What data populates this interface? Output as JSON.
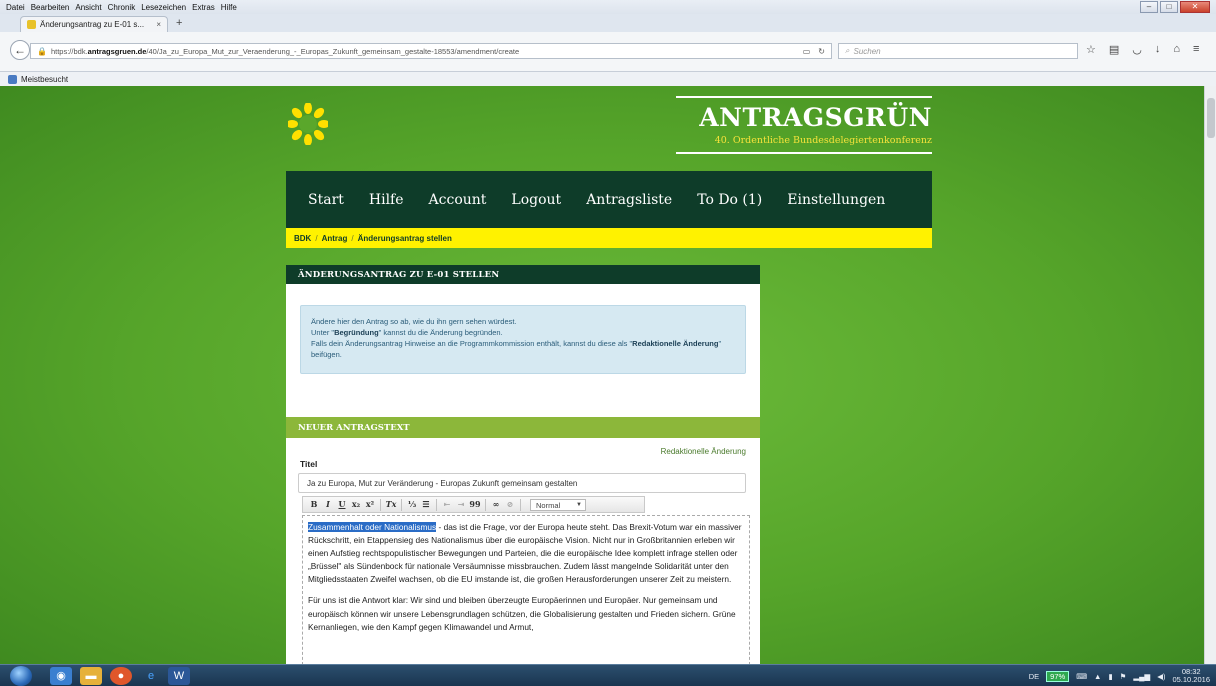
{
  "browser": {
    "menu": [
      {
        "label": "Datei"
      },
      {
        "label": "Bearbeiten"
      },
      {
        "label": "Ansicht"
      },
      {
        "label": "Chronik"
      },
      {
        "label": "Lesezeichen"
      },
      {
        "label": "Extras"
      },
      {
        "label": "Hilfe"
      }
    ],
    "tab_title": "Änderungsantrag zu E-01 s...",
    "tab_close": "×",
    "new_tab": "+",
    "url_host": "https://bdk.antragsgruen.de",
    "url_host_bold": "antragsgruen.de",
    "url_path": "/40/Ja_zu_Europa_Mut_zur_Veraenderung_-_Europas_Zukunft_gemeinsam_gestalte-18553/amendment/create",
    "search_placeholder": "Suchen",
    "bookmark_folder": "Meistbesucht"
  },
  "site": {
    "brand_title": "ANTRAGSGRÜN",
    "brand_subtitle": "40. Ordentliche Bundesdelegiertenkonferenz",
    "nav": [
      {
        "label": "Start"
      },
      {
        "label": "Hilfe"
      },
      {
        "label": "Account"
      },
      {
        "label": "Logout"
      },
      {
        "label": "Antragsliste"
      },
      {
        "label": "To Do (1)"
      },
      {
        "label": "Einstellungen"
      }
    ],
    "breadcrumb": [
      {
        "label": "BDK"
      },
      {
        "label": "Antrag"
      },
      {
        "label": "Änderungsantrag stellen"
      }
    ]
  },
  "form": {
    "heading": "ÄNDERUNGSANTRAG ZU E-01 STELLEN",
    "hint": {
      "line1": "Ändere hier den Antrag so ab, wie du ihn gern sehen würdest.",
      "line2_pre": "Unter \"",
      "line2_bold": "Begründung",
      "line2_post": "\" kannst du die Änderung begründen.",
      "line3_pre": "Falls dein Änderungsantrag Hinweise an die Programmkommission enthält, kannst du diese als \"",
      "line3_bold": "Redaktionelle Änderung",
      "line3_post": "\" beifügen."
    },
    "section_heading": "NEUER ANTRAGSTEXT",
    "editorial_link": "Redaktionelle Änderung",
    "title_label": "Titel",
    "title_value": "Ja zu Europa, Mut zur Veränderung - Europas Zukunft gemeinsam gestalten",
    "toolbar": {
      "bold": "B",
      "italic": "I",
      "underline": "U",
      "subscript": "x₂",
      "superscript": "x²",
      "clear_format": "Tx",
      "ordered_list": "⅓",
      "bullet_list": "☰",
      "outdent": "⇤",
      "indent": "⇥",
      "quote": "99",
      "link": "∞",
      "unlink": "⊘",
      "format_select": "Normal"
    },
    "body": {
      "p1_highlight": "Zusammenhalt oder Nationalismus",
      "p1_rest": " - das ist die Frage, vor der Europa heute steht. Das Brexit-Votum war ein massiver Rückschritt, ein Etappensieg des Nationalismus über die europäische Vision. Nicht nur in Großbritannien erleben wir einen Aufstieg rechtspopulistischer Bewegungen und Parteien, die die europäische Idee komplett infrage stellen oder „Brüssel\" als Sündenbock für nationale Versäumnisse missbrauchen. Zudem lässt mangelnde Solidarität unter den Mitgliedsstaaten Zweifel wachsen, ob die EU imstande ist, die großen Herausforderungen unserer Zeit zu meistern.",
      "p2": "Für uns ist die Antwort klar: Wir sind und bleiben überzeugte Europäerinnen und Europäer. Nur gemeinsam und europäisch können wir unsere Lebensgrundlagen schützen, die Globalisierung gestalten und Frieden sichern. Grüne Kernanliegen, wie den Kampf gegen Klimawandel und Armut,"
    }
  },
  "taskbar": {
    "lang": "DE",
    "battery": "97%",
    "time": "08:32",
    "date": "05.10.2016"
  },
  "colors": {
    "nav_dark": "#0e3c29",
    "crumb_yellow": "#fff200",
    "section_green": "#8cb73a",
    "brand_subtitle": "#f5e23a"
  }
}
